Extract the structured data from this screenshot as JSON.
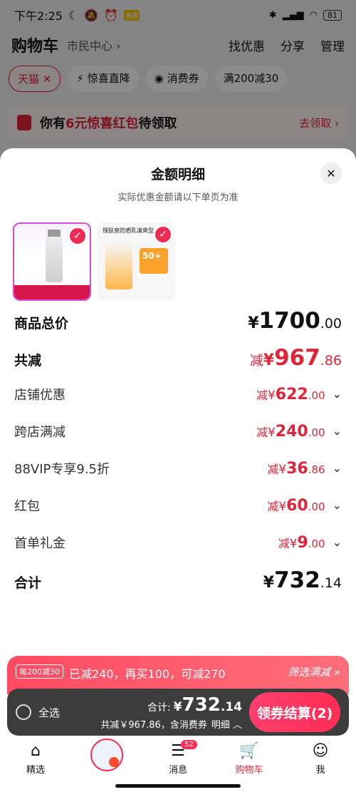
{
  "status_bar": {
    "time": "下午2:25",
    "icons_left": [
      "moon-icon",
      "bell-off-icon",
      "alarm-icon"
    ],
    "app_badge": "美团",
    "battery": "81"
  },
  "cart_header": {
    "title": "购物车",
    "location": "市民中心",
    "actions": [
      "找优惠",
      "分享",
      "管理"
    ]
  },
  "chips": [
    {
      "label": "天猫",
      "active": true
    },
    {
      "label": "惊喜直降",
      "active": false
    },
    {
      "label": "消费券",
      "active": false
    },
    {
      "label": "满200减30",
      "active": false
    }
  ],
  "banner": {
    "prefix": "你有",
    "highlight": "6元惊喜红包",
    "suffix": "待领取",
    "action": "去领取"
  },
  "sheet": {
    "title": "金额明细",
    "subtitle": "实际优惠金额请以下单页为准",
    "products": [
      {
        "name": "SK-II",
        "selected": true
      },
      {
        "name": "理肤泉防晒乳清爽型",
        "spf": "50+",
        "selected": true
      }
    ],
    "total_price": {
      "label": "商品总价",
      "currency": "¥",
      "int": "1700",
      "dec": ".00"
    },
    "total_discount": {
      "label": "共减",
      "prefix": "减",
      "currency": "¥",
      "int": "967",
      "dec": ".86"
    },
    "discounts": [
      {
        "label": "店铺优惠",
        "prefix": "减",
        "currency": "¥",
        "int": "622",
        "dec": ".00"
      },
      {
        "label": "跨店满减",
        "prefix": "减",
        "currency": "¥",
        "int": "240",
        "dec": ".00"
      },
      {
        "label": "88VIP专享9.5折",
        "prefix": "减",
        "currency": "¥",
        "int": "36",
        "dec": ".86"
      },
      {
        "label": "红包",
        "prefix": "减",
        "currency": "¥",
        "int": "60",
        "dec": ".00"
      },
      {
        "label": "首单礼金",
        "prefix": "减",
        "currency": "¥",
        "int": "9",
        "dec": ".00"
      }
    ],
    "sum": {
      "label": "合计",
      "currency": "¥",
      "int": "732",
      "dec": ".14"
    }
  },
  "promo_bar": {
    "tag": "每200减30",
    "text": "已减240，再买100，可减270",
    "link": "筛选满减"
  },
  "checkout": {
    "select_all": "全选",
    "total_label": "合计:",
    "currency": "¥",
    "total_int": "732",
    "total_dec": ".14",
    "sub_text": "共减￥967.86，含消费券",
    "detail": "明细",
    "pay_button": "领券结算(2)"
  },
  "tabbar": [
    {
      "label": "精选",
      "icon": "home-icon"
    },
    {
      "label": "",
      "icon": "promo-image"
    },
    {
      "label": "消息",
      "icon": "message-icon",
      "badge": "52"
    },
    {
      "label": "购物车",
      "icon": "cart-icon",
      "active": true
    },
    {
      "label": "我",
      "icon": "profile-icon"
    }
  ],
  "colors": {
    "accent": "#e0243a",
    "pay_button": "#ff2d55",
    "checkout_bg": "#3c3c3c"
  }
}
